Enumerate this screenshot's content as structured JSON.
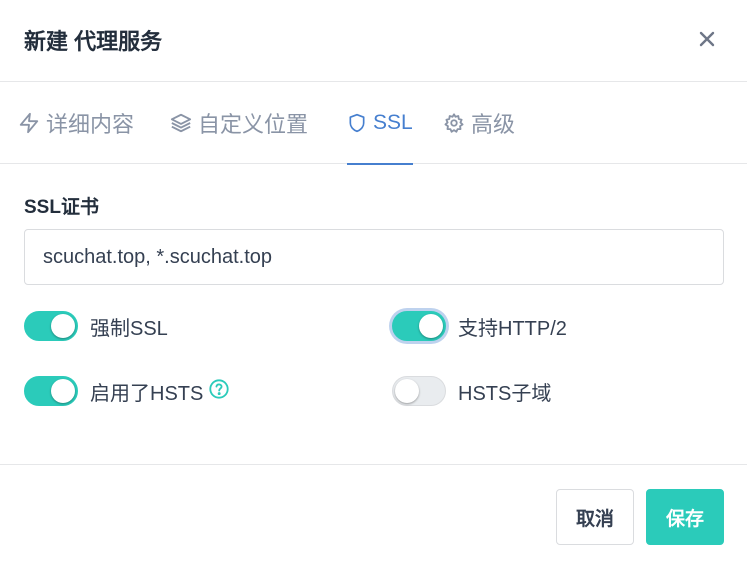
{
  "dialog": {
    "title": "新建 代理服务"
  },
  "tabs": [
    {
      "label": "详细内容",
      "icon": "zap-icon"
    },
    {
      "label": "自定义位置",
      "icon": "layers-icon"
    },
    {
      "label": "SSL",
      "icon": "shield-icon",
      "active": true
    },
    {
      "label": "高级",
      "icon": "gear-icon"
    }
  ],
  "ssl": {
    "cert_label": "SSL证书",
    "cert_value": "scuchat.top, *.scuchat.top",
    "toggles": [
      {
        "label": "强制SSL",
        "on": true
      },
      {
        "label": "支持HTTP/2",
        "on": true
      },
      {
        "label": "启用了HSTS",
        "on": true
      },
      {
        "label": "HSTS子域",
        "on": false
      }
    ]
  },
  "footer": {
    "cancel_label": "取消",
    "save_label": "保存"
  },
  "colors": {
    "accent": "#2bcbba",
    "tab_active": "#467fcf",
    "text": "#354052",
    "muted": "#8a94a6"
  }
}
